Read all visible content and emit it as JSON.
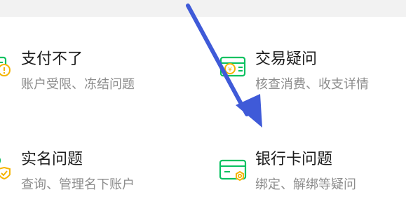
{
  "colors": {
    "accent": "#07c160",
    "icon_secondary": "#f5b400",
    "annotation_arrow": "#3f5ad8",
    "title_text": "#1a1a1a",
    "subtitle_text": "#8c8c8c"
  },
  "help_topics": [
    {
      "title": "支付不了",
      "subtitle": "账户受限、冻结问题",
      "icon": "blocked-payment-icon"
    },
    {
      "title": "交易疑问",
      "subtitle": "核查消费、收支详情",
      "icon": "transaction-query-icon"
    },
    {
      "title": "实名问题",
      "subtitle": "查询、管理名下账户",
      "icon": "real-name-verification-icon"
    },
    {
      "title": "银行卡问题",
      "subtitle": "绑定、解绑等疑问",
      "icon": "bank-card-icon"
    }
  ]
}
